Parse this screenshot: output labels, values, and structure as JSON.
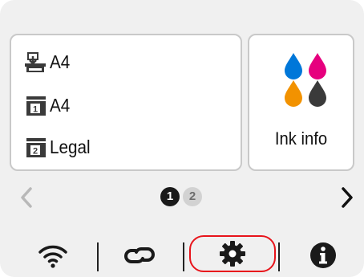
{
  "paper_settings": {
    "items": [
      {
        "source": "rear-tray",
        "size": "A4"
      },
      {
        "source": "cassette-1",
        "size": "A4"
      },
      {
        "source": "cassette-2",
        "size": "Legal"
      }
    ],
    "tray_numbers": [
      "1",
      "2"
    ]
  },
  "ink_info": {
    "label": "Ink info",
    "ink_colors": [
      "#0077d9",
      "#e6007e",
      "#f29200",
      "#3a3a3a"
    ]
  },
  "pager": {
    "current_page": "1",
    "other_page": "2"
  },
  "bottom_bar": {
    "icons": [
      "wifi-icon",
      "wireless-direct-link-icon",
      "gear-icon",
      "info-icon"
    ],
    "highlight_color": "#e8141b"
  }
}
